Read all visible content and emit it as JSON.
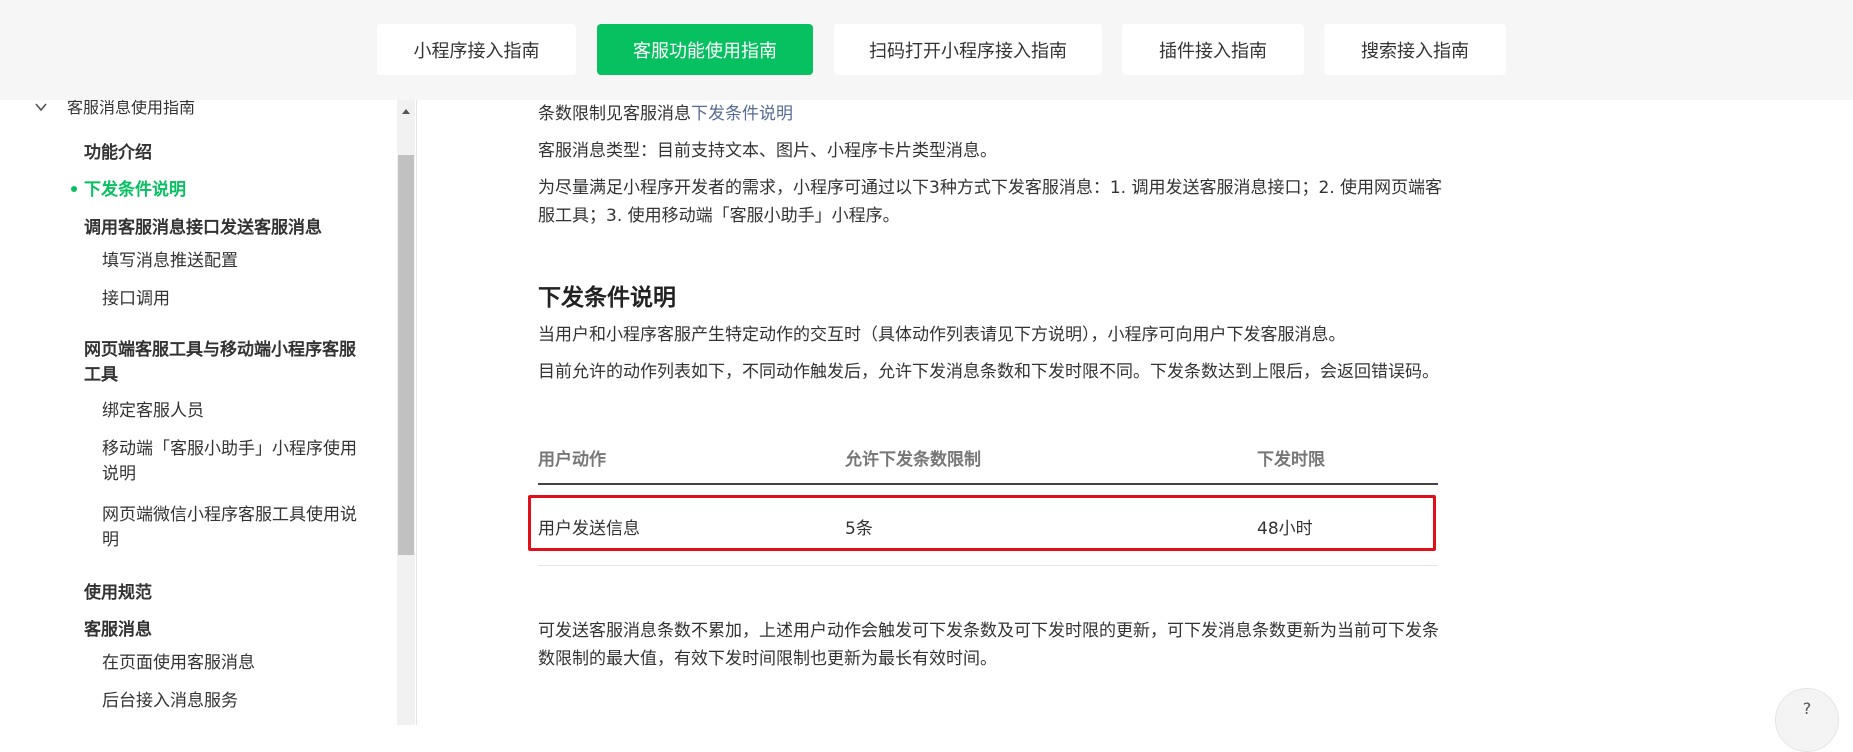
{
  "tabs": [
    {
      "label": "小程序接入指南",
      "active": false
    },
    {
      "label": "客服功能使用指南",
      "active": true
    },
    {
      "label": "扫码打开小程序接入指南",
      "active": false
    },
    {
      "label": "插件接入指南",
      "active": false
    },
    {
      "label": "搜索接入指南",
      "active": false
    }
  ],
  "sidebar": {
    "section_title": "客服消息使用指南",
    "items": [
      {
        "label": "功能介绍"
      },
      {
        "label": "下发条件说明"
      },
      {
        "label": "调用客服消息接口发送客服消息"
      },
      {
        "label": "填写消息推送配置"
      },
      {
        "label": "接口调用"
      },
      {
        "label": "网页端客服工具与移动端小程序客服工具"
      },
      {
        "label": "绑定客服人员"
      },
      {
        "label": "移动端「客服小助手」小程序使用说明"
      },
      {
        "label": "网页端微信小程序客服工具使用说明"
      },
      {
        "label": "使用规范"
      },
      {
        "label": "客服消息"
      },
      {
        "label": "在页面使用客服消息"
      },
      {
        "label": "后台接入消息服务"
      }
    ]
  },
  "main": {
    "p0_prefix": "条数限制见客服消息",
    "p0_link": "下发条件说明",
    "p1": "客服消息类型：目前支持文本、图片、小程序卡片类型消息。",
    "p2": "为尽量满足小程序开发者的需求，小程序可通过以下3种方式下发客服消息：1. 调用发送客服消息接口；2. 使用网页端客服工具；3. 使用移动端「客服小助手」小程序。",
    "heading": "下发条件说明",
    "p3": "当用户和小程序客服产生特定动作的交互时（具体动作列表请见下方说明），小程序可向用户下发客服消息。",
    "p4": "目前允许的动作列表如下，不同动作触发后，允许下发消息条数和下发时限不同。下发条数达到上限后，会返回错误码。",
    "table": {
      "headers": [
        "用户动作",
        "允许下发条数限制",
        "下发时限"
      ],
      "rows": [
        [
          "用户发送信息",
          "5条",
          "48小时"
        ]
      ]
    },
    "p5": "可发送客服消息条数不累加，上述用户动作会触发可下发条数及可下发时限的更新，可下发消息条数更新为当前可下发条数限制的最大值，有效下发时间限制也更新为最长有效时间。"
  },
  "help_label": "?"
}
